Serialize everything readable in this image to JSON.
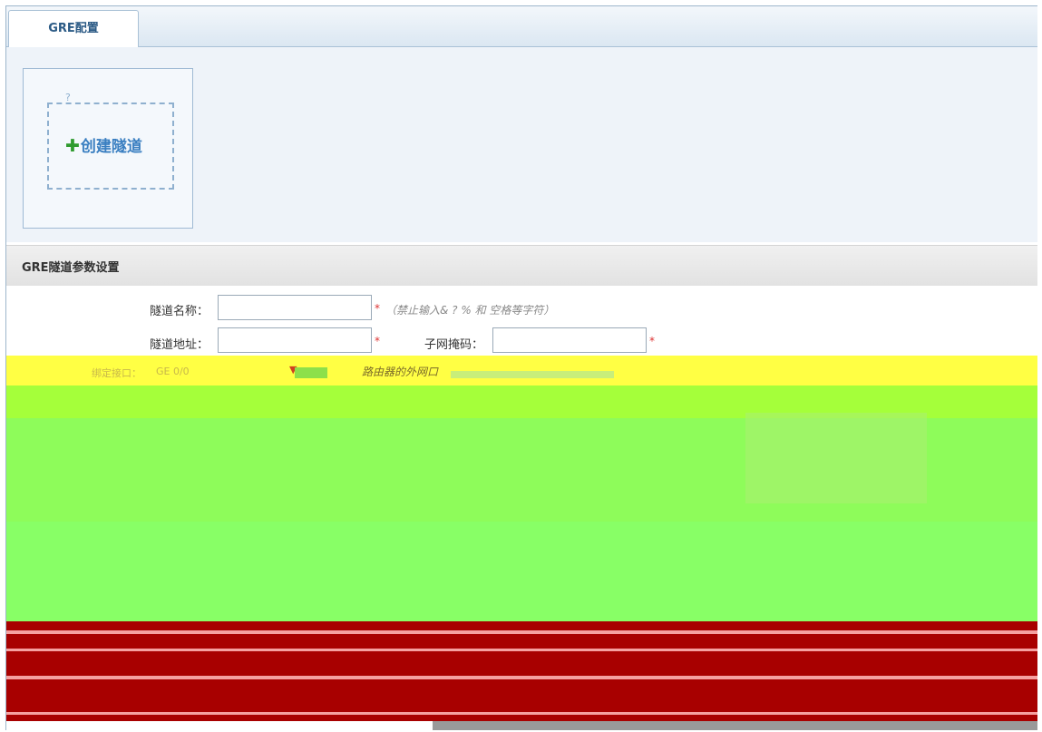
{
  "tab": {
    "label": "GRE配置"
  },
  "create": {
    "label": "创建隧道",
    "icon": "plus-icon",
    "marker": "?"
  },
  "section": {
    "title": "GRE隧道参数设置"
  },
  "fields": {
    "tunnel_name_label": "隧道名称：",
    "tunnel_name_value": "",
    "tunnel_name_hint": "（禁止输入& ? % 和 空格等字符）",
    "tunnel_addr_label": "隧道地址：",
    "tunnel_addr_value": "",
    "subnet_label": "子网掩码：",
    "subnet_value": "",
    "iface_label": "绑定接口：",
    "iface_value": "GE 0/0",
    "iface_hint": "路由器的外网口",
    "required_mark": "*"
  },
  "colors": {
    "accent": "#3a7fc1",
    "plus": "#2f9b2f",
    "required": "#d33333",
    "glitch_yellow": "#ffff33",
    "glitch_green": "#88ff55",
    "glitch_red": "#a80000"
  }
}
